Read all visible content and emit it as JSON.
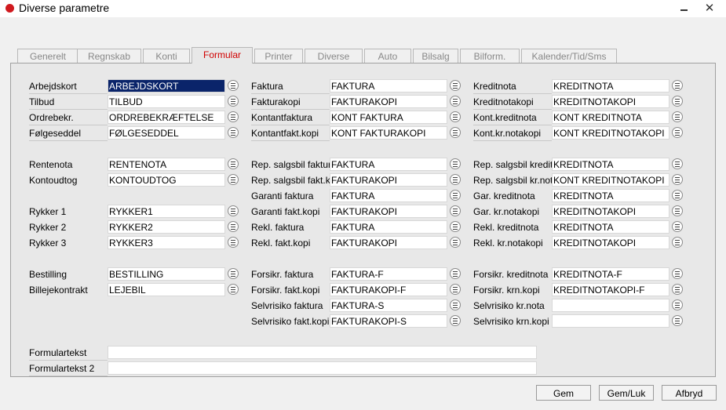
{
  "window": {
    "title": "Diverse parametre",
    "minimize": "–",
    "close": "✕"
  },
  "tabs": [
    "Generelt",
    "Regnskab",
    "Konti",
    "Formular",
    "Printer",
    "Diverse",
    "Auto",
    "Bilsalg",
    "Bilform.",
    "Kalender/Tid/Sms"
  ],
  "active_tab": "Formular",
  "col1": [
    {
      "label": "Arbejdskort",
      "value": "ARBEJDSKORT"
    },
    {
      "label": "Tilbud",
      "value": "TILBUD"
    },
    {
      "label": "Ordrebekr.",
      "value": "ORDREBEKRÆFTELSE"
    },
    {
      "label": "Følgeseddel",
      "value": "FØLGESEDDEL"
    },
    {
      "label": "Rentenota",
      "value": "RENTENOTA"
    },
    {
      "label": "Kontoudtog",
      "value": "KONTOUDTOG"
    },
    {
      "label": "Rykker 1",
      "value": "RYKKER1"
    },
    {
      "label": "Rykker 2",
      "value": "RYKKER2"
    },
    {
      "label": "Rykker 3",
      "value": "RYKKER3"
    },
    {
      "label": "Bestilling",
      "value": "BESTILLING"
    },
    {
      "label": "Billejekontrakt",
      "value": "LEJEBIL"
    }
  ],
  "col2": [
    {
      "label": "Faktura",
      "value": "FAKTURA"
    },
    {
      "label": "Fakturakopi",
      "value": "FAKTURAKOPI"
    },
    {
      "label": "Kontantfaktura",
      "value": "KONT FAKTURA"
    },
    {
      "label": "Kontantfakt.kopi",
      "value": "KONT FAKTURAKOPI"
    },
    {
      "label": "Rep. salgsbil faktura",
      "value": "FAKTURA"
    },
    {
      "label": "Rep. salgsbil fakt.kopi",
      "value": "FAKTURAKOPI"
    },
    {
      "label": "Garanti faktura",
      "value": "FAKTURA"
    },
    {
      "label": "Garanti fakt.kopi",
      "value": "FAKTURAKOPI"
    },
    {
      "label": "Rekl. faktura",
      "value": "FAKTURA"
    },
    {
      "label": "Rekl. fakt.kopi",
      "value": "FAKTURAKOPI"
    },
    {
      "label": "Forsikr. faktura",
      "value": "FAKTURA-F"
    },
    {
      "label": "Forsikr. fakt.kopi",
      "value": "FAKTURAKOPI-F"
    },
    {
      "label": "Selvrisiko faktura",
      "value": "FAKTURA-S"
    },
    {
      "label": "Selvrisiko fakt.kopi",
      "value": "FAKTURAKOPI-S"
    }
  ],
  "col3": [
    {
      "label": "Kreditnota",
      "value": "KREDITNOTA"
    },
    {
      "label": "Kreditnotakopi",
      "value": "KREDITNOTAKOPI"
    },
    {
      "label": "Kont.kreditnota",
      "value": "KONT KREDITNOTA"
    },
    {
      "label": "Kont.kr.notakopi",
      "value": "KONT KREDITNOTAKOPI"
    },
    {
      "label": "Rep. salgsbil kreditnota",
      "value": "KREDITNOTA"
    },
    {
      "label": "Rep. salgsbil kr.notakopi",
      "value": "KONT KREDITNOTAKOPI"
    },
    {
      "label": "Gar. kreditnota",
      "value": "KREDITNOTA"
    },
    {
      "label": "Gar. kr.notakopi",
      "value": "KREDITNOTAKOPI"
    },
    {
      "label": "Rekl. kreditnota",
      "value": "KREDITNOTA"
    },
    {
      "label": "Rekl. kr.notakopi",
      "value": "KREDITNOTAKOPI"
    },
    {
      "label": "Forsikr. kreditnota",
      "value": "KREDITNOTA-F"
    },
    {
      "label": "Forsikr. krn.kopi",
      "value": "KREDITNOTAKOPI-F"
    },
    {
      "label": "Selvrisiko kr.nota",
      "value": ""
    },
    {
      "label": "Selvrisiko krn.kopi",
      "value": ""
    }
  ],
  "formulartekst": [
    {
      "label": "Formulartekst",
      "value": ""
    },
    {
      "label": "Formulartekst 2",
      "value": ""
    }
  ],
  "buttons": {
    "gem": "Gem",
    "gem_luk": "Gem/Luk",
    "afbryd": "Afbryd"
  }
}
